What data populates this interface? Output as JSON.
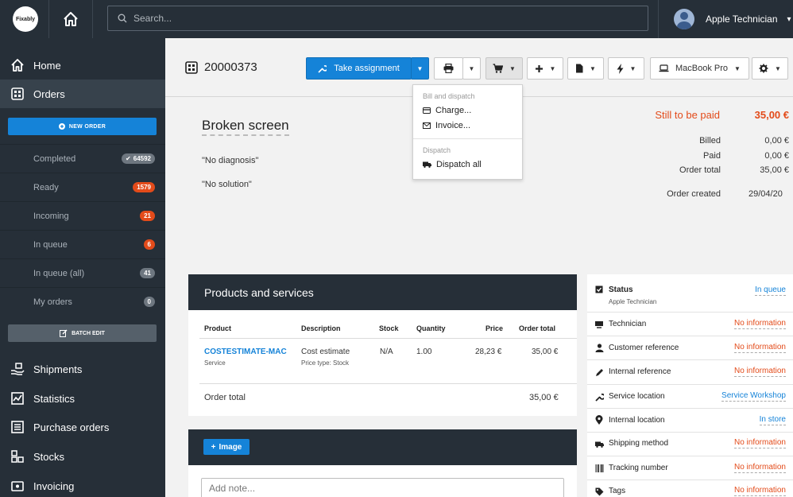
{
  "topbar": {
    "logo_text": "Fixably",
    "search_placeholder": "Search...",
    "user_name": "Apple Technician"
  },
  "sidebar": {
    "home": "Home",
    "orders": "Orders",
    "new_order": "NEW ORDER",
    "sub_items": [
      {
        "label": "Completed",
        "count": "64592",
        "color": "#6e7780"
      },
      {
        "label": "Ready",
        "count": "1579",
        "color": "#e34b1a"
      },
      {
        "label": "Incoming",
        "count": "21",
        "color": "#e34b1a"
      },
      {
        "label": "In queue",
        "count": "6",
        "color": "#e34b1a"
      },
      {
        "label": "In queue (all)",
        "count": "41",
        "color": "#6e7780"
      },
      {
        "label": "My orders",
        "count": "0",
        "color": "#6e7780"
      }
    ],
    "batch_edit": "BATCH EDIT",
    "bottom_items": [
      "Shipments",
      "Statistics",
      "Purchase orders",
      "Stocks",
      "Invoicing"
    ]
  },
  "header": {
    "order_number": "20000373",
    "take_assignment": "Take assignment",
    "device": "MacBook Pro"
  },
  "dropdown": {
    "section1": "Bill and dispatch",
    "charge": "Charge...",
    "invoice": "Invoice...",
    "section2": "Dispatch",
    "dispatch_all": "Dispatch all"
  },
  "order": {
    "title": "Broken screen",
    "diagnosis": "\"No diagnosis\"",
    "solution": "\"No solution\""
  },
  "summary": {
    "still_label": "Still to be paid",
    "still_value": "35,00 €",
    "rows": [
      {
        "label": "Billed",
        "value": "0,00 €"
      },
      {
        "label": "Paid",
        "value": "0,00 €"
      },
      {
        "label": "Order total",
        "value": "35,00 €"
      }
    ],
    "created_label": "Order created",
    "created_value": "29/04/20"
  },
  "products": {
    "title": "Products and services",
    "headers": {
      "product": "Product",
      "description": "Description",
      "stock": "Stock",
      "quantity": "Quantity",
      "price": "Price",
      "order_total": "Order total"
    },
    "row": {
      "product": "COSTESTIMATE-MAC",
      "product_sub": "Service",
      "description": "Cost estimate",
      "description_sub": "Price type: Stock",
      "stock": "N/A",
      "quantity": "1.00",
      "price": "28,23 €",
      "total": "35,00 €"
    },
    "footer_label": "Order total",
    "footer_value": "35,00 €"
  },
  "notes": {
    "image_button": "Image",
    "placeholder": "Add note..."
  },
  "info": {
    "status_label": "Status",
    "status_sub": "Apple Technician",
    "status_value": "In queue",
    "rows": [
      {
        "label": "Technician",
        "value": "No information"
      },
      {
        "label": "Customer reference",
        "value": "No information"
      },
      {
        "label": "Internal reference",
        "value": "No information"
      },
      {
        "label": "Service location",
        "value": "Service Workshop"
      },
      {
        "label": "Internal location",
        "value": "In store"
      },
      {
        "label": "Shipping method",
        "value": "No information"
      },
      {
        "label": "Tracking number",
        "value": "No information"
      },
      {
        "label": "Tags",
        "value": "No information"
      }
    ]
  },
  "colors": {
    "accent": "#1583d8",
    "sidebar": "#262f38",
    "warning": "#e34b1a"
  }
}
